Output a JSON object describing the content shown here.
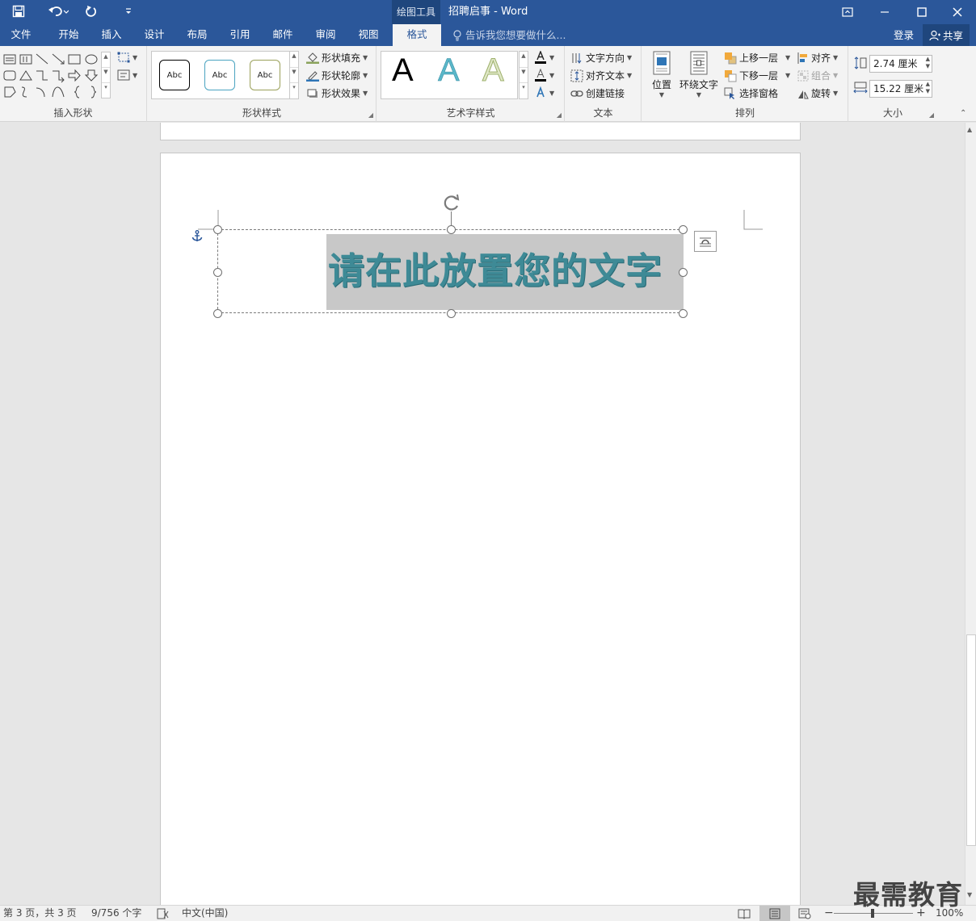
{
  "title_bar": {
    "context_tool": "绘图工具",
    "document_title": "招聘启事 - Word",
    "quick_access": [
      "save-icon",
      "undo-icon",
      "redo-icon",
      "customize-icon"
    ]
  },
  "tabs": [
    {
      "label": "文件"
    },
    {
      "label": "开始"
    },
    {
      "label": "插入"
    },
    {
      "label": "设计"
    },
    {
      "label": "布局"
    },
    {
      "label": "引用"
    },
    {
      "label": "邮件"
    },
    {
      "label": "审阅"
    },
    {
      "label": "视图"
    },
    {
      "label": "格式"
    }
  ],
  "active_tab": "格式",
  "tell_me": "告诉我您想要做什么...",
  "account": {
    "login": "登录",
    "share": "共享"
  },
  "ribbon": {
    "insert_shapes": {
      "label": "插入形状"
    },
    "shape_styles": {
      "label": "形状样式",
      "previews": [
        "Abc",
        "Abc",
        "Abc"
      ],
      "fill": "形状填充",
      "outline": "形状轮廓",
      "effects": "形状效果"
    },
    "wordart_styles": {
      "label": "艺术字样式",
      "previews": [
        "A",
        "A",
        "A"
      ]
    },
    "text": {
      "label": "文本",
      "direction": "文字方向",
      "align": "对齐文本",
      "link": "创建链接"
    },
    "arrange": {
      "label": "排列",
      "position": "位置",
      "wrap": "环绕文字",
      "bring_forward": "上移一层",
      "send_backward": "下移一层",
      "selection_pane": "选择窗格",
      "align": "对齐",
      "group": "组合",
      "rotate": "旋转"
    },
    "size": {
      "label": "大小",
      "height": "2.74 厘米",
      "width": "15.22 厘米"
    }
  },
  "document": {
    "textbox_text": "请在此放置您的文字"
  },
  "status_bar": {
    "page": "第 3 页，共 3 页",
    "words": "9/756 个字",
    "language": "中文(中国)",
    "zoom": "100%"
  },
  "watermark": "最需教育",
  "colors": {
    "accent": "#2b579a",
    "wordart_text": "#3e8a96",
    "text_highlight": "#c8c8c8"
  }
}
